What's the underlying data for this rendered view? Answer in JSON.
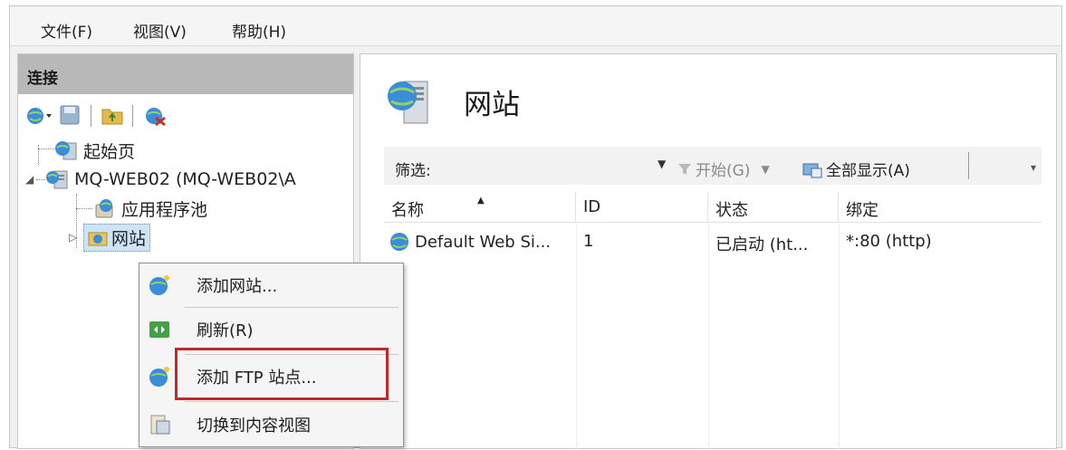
{
  "menu": {
    "file": "文件(F)",
    "view": "视图(V)",
    "help": "帮助(H)"
  },
  "connections": {
    "title": "连接",
    "tree": {
      "start_page": "起始页",
      "server": "MQ-WEB02 (MQ-WEB02\\A",
      "app_pools": "应用程序池",
      "sites": "网站"
    }
  },
  "content": {
    "title": "网站",
    "filter": {
      "label": "筛选:",
      "value": "",
      "start": "开始(G)",
      "show_all": "全部显示(A)"
    },
    "columns": [
      "名称",
      "ID",
      "状态",
      "绑定"
    ],
    "rows": [
      {
        "name": "Default Web Si...",
        "id": "1",
        "status": "已启动 (ht...",
        "binding": "*:80 (http)"
      }
    ]
  },
  "context_menu": {
    "items": [
      "添加网站...",
      "刷新(R)",
      "添加 FTP 站点...",
      "切换到内容视图"
    ]
  },
  "colors": {
    "highlight": "#c0282d",
    "header_gray": "#b8b8b8",
    "globe": "#2f7fc1"
  }
}
